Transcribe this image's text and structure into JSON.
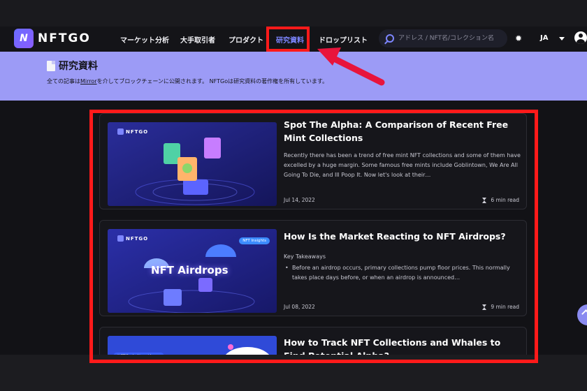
{
  "colors": {
    "accent": "#7d86ff",
    "banner": "#9c9bf6",
    "highlight": "#ff1a1a",
    "background": "#121216"
  },
  "navbar": {
    "logo_text": "NFTGO",
    "logo_mark": "N",
    "items": [
      {
        "label": "マーケット分析"
      },
      {
        "label": "大手取引者"
      },
      {
        "label": "プロダクト"
      },
      {
        "label": "研究資料",
        "active": true
      },
      {
        "label": "ドロップリスト"
      }
    ],
    "search_placeholder": "アドレス / NFT名/コレクション名",
    "language": "JA",
    "icons": [
      "search-icon",
      "sun-icon",
      "chevron-down-icon",
      "user-icon"
    ]
  },
  "banner": {
    "title": "研究資料",
    "desc_before": "全ての記事は",
    "desc_link": "Mirror",
    "desc_after": "を介してブロックチェーンに公開されます。 NFTGoは研究資料の著作権を所有しています。"
  },
  "articles": [
    {
      "title": "Spot The Alpha: A Comparison of Recent Free Mint Collections",
      "excerpt": "Recently there has been a trend of free mint NFT collections and some of them have excelled by a huge margin. Some famous free mints include Goblintown, We Are All Going To Die, and Ill Poop It. Now let's look at their…",
      "date": "Jul 14, 2022",
      "read_time": "6 min read",
      "thumb_logo": "NFTGO"
    },
    {
      "title": "How Is the Market Reacting to NFT Airdrops?",
      "excerpt_title": "Key Takeaways",
      "excerpt_bullet": "Before an airdrop occurs, primary collections pump floor prices. This normally takes place days before, or when an airdrop is announced…",
      "date": "Jul 08, 2022",
      "read_time": "9 min read",
      "thumb_logo": "NFTGO",
      "thumb_label": "NFT Airdrops",
      "thumb_pill": "NFT Insights"
    },
    {
      "title": "How to Track NFT Collections and Whales to Find Potential Alpha?",
      "thumb_pill": "NFTGo is Now Live..."
    }
  ]
}
